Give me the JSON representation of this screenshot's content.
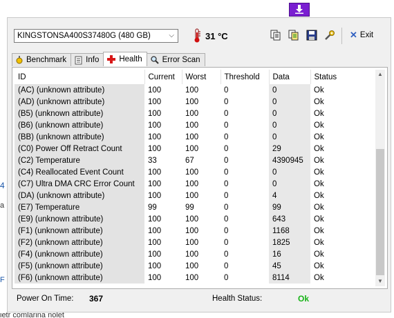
{
  "colors": {
    "ok_status": "#18b418",
    "window_bg": "#f0f0f0",
    "id_column_bg": "#e3e3e3"
  },
  "toolbar": {
    "drive": "KINGSTONSA400S37480G (480 GB)",
    "temperature": "31 °C",
    "exit_label": "Exit",
    "icons": [
      "copy-icon",
      "copy-all-icon",
      "save-icon",
      "tools-icon"
    ]
  },
  "tabs": [
    {
      "label": "Benchmark",
      "icon": "benchmark-icon"
    },
    {
      "label": "Info",
      "icon": "info-icon"
    },
    {
      "label": "Health",
      "icon": "health-cross-icon",
      "active": true
    },
    {
      "label": "Error Scan",
      "icon": "magnifier-icon"
    }
  ],
  "table": {
    "columns": [
      "ID",
      "Current",
      "Worst",
      "Threshold",
      "Data",
      "Status"
    ],
    "rows": [
      [
        "(AC) (unknown attribute)",
        "100",
        "100",
        "0",
        "0",
        "Ok"
      ],
      [
        "(AD) (unknown attribute)",
        "100",
        "100",
        "0",
        "0",
        "Ok"
      ],
      [
        "(B5) (unknown attribute)",
        "100",
        "100",
        "0",
        "0",
        "Ok"
      ],
      [
        "(B6) (unknown attribute)",
        "100",
        "100",
        "0",
        "0",
        "Ok"
      ],
      [
        "(BB) (unknown attribute)",
        "100",
        "100",
        "0",
        "0",
        "Ok"
      ],
      [
        "(C0) Power Off Retract Count",
        "100",
        "100",
        "0",
        "29",
        "Ok"
      ],
      [
        "(C2) Temperature",
        "33",
        "67",
        "0",
        "4390945",
        "Ok"
      ],
      [
        "(C4) Reallocated Event Count",
        "100",
        "100",
        "0",
        "0",
        "Ok"
      ],
      [
        "(C7) Ultra DMA CRC Error Count",
        "100",
        "100",
        "0",
        "0",
        "Ok"
      ],
      [
        "(DA) (unknown attribute)",
        "100",
        "100",
        "0",
        "4",
        "Ok"
      ],
      [
        "(E7) Temperature",
        "99",
        "99",
        "0",
        "99",
        "Ok"
      ],
      [
        "(E9) (unknown attribute)",
        "100",
        "100",
        "0",
        "643",
        "Ok"
      ],
      [
        "(F1) (unknown attribute)",
        "100",
        "100",
        "0",
        "1168",
        "Ok"
      ],
      [
        "(F2) (unknown attribute)",
        "100",
        "100",
        "0",
        "1825",
        "Ok"
      ],
      [
        "(F4) (unknown attribute)",
        "100",
        "100",
        "0",
        "16",
        "Ok"
      ],
      [
        "(F5) (unknown attribute)",
        "100",
        "100",
        "0",
        "45",
        "Ok"
      ],
      [
        "(F6) (unknown attribute)",
        "100",
        "100",
        "0",
        "8114",
        "Ok"
      ]
    ]
  },
  "status": {
    "power_on_time_label": "Power On Time:",
    "power_on_time_value": "367",
    "health_status_label": "Health Status:",
    "health_status_value": "Ok"
  },
  "background": {
    "left_fragment_a": "4",
    "left_fragment_b": "a",
    "left_fragment_c": "F",
    "bottom_fragment": "ietr comlarina nolet"
  }
}
